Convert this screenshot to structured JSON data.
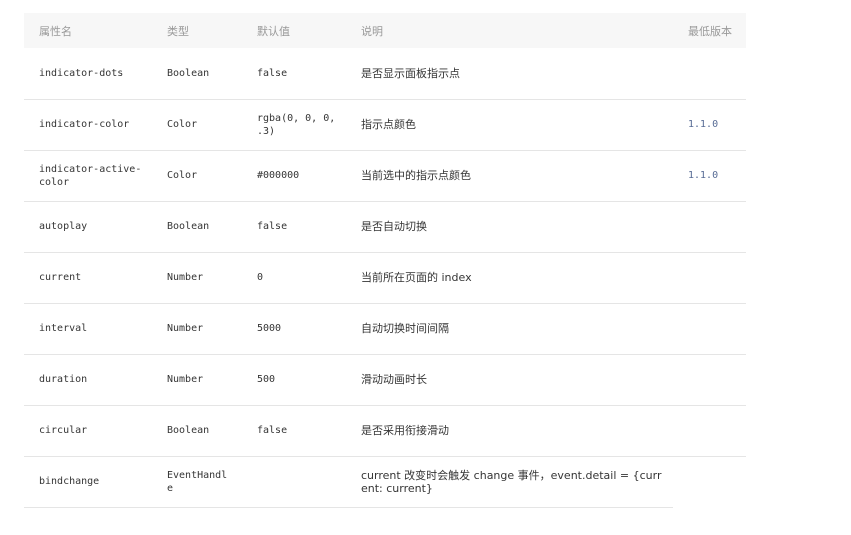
{
  "table": {
    "headers": {
      "name": "属性名",
      "type": "类型",
      "default": "默认值",
      "desc": "说明",
      "version": "最低版本"
    },
    "rows": [
      {
        "name": "indicator-dots",
        "type": "Boolean",
        "default": "false",
        "desc": "是否显示面板指示点",
        "version": ""
      },
      {
        "name": "indicator-color",
        "type": "Color",
        "default": "rgba(0, 0, 0, .3)",
        "desc": "指示点颜色",
        "version": "1.1.0"
      },
      {
        "name": "indicator-active-color",
        "type": "Color",
        "default": "#000000",
        "desc": "当前选中的指示点颜色",
        "version": "1.1.0"
      },
      {
        "name": "autoplay",
        "type": "Boolean",
        "default": "false",
        "desc": "是否自动切换",
        "version": ""
      },
      {
        "name": "current",
        "type": "Number",
        "default": "0",
        "desc": "当前所在页面的 index",
        "version": ""
      },
      {
        "name": "interval",
        "type": "Number",
        "default": "5000",
        "desc": "自动切换时间间隔",
        "version": ""
      },
      {
        "name": "duration",
        "type": "Number",
        "default": "500",
        "desc": "滑动动画时长",
        "version": ""
      },
      {
        "name": "circular",
        "type": "Boolean",
        "default": "false",
        "desc": "是否采用衔接滑动",
        "version": ""
      },
      {
        "name": "bindchange",
        "type": "EventHandle",
        "default": "",
        "desc": "current 改变时会触发 change 事件，event.detail = {current: current}",
        "version": ""
      }
    ]
  },
  "colors": {
    "header_bg": "#f7f7f7",
    "header_text": "#999999",
    "version_link": "#576b95",
    "row_border": "#e5e5e5"
  }
}
